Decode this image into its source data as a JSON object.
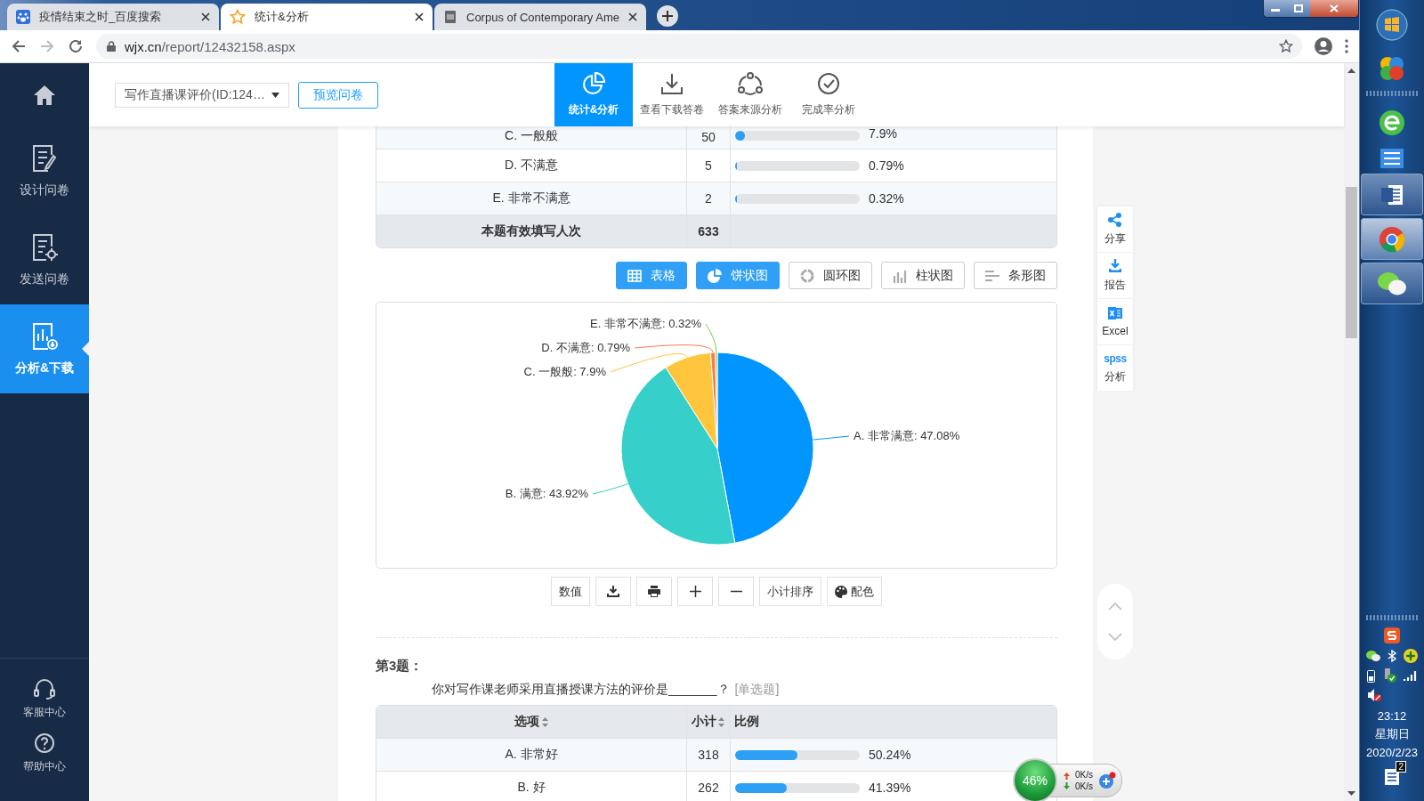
{
  "browser": {
    "tabs": [
      {
        "title": "疫情结束之时_百度搜索",
        "selected": false
      },
      {
        "title": "统计&分析",
        "selected": true
      },
      {
        "title": "Corpus of Contemporary Ame",
        "selected": false
      }
    ],
    "address": {
      "host": "wjx.cn",
      "path": "/report/12432158.aspx"
    }
  },
  "sidebar": {
    "items": [
      {
        "label": "设计问卷",
        "selected": false
      },
      {
        "label": "发送问卷",
        "selected": false
      },
      {
        "label": "分析&下载",
        "selected": true
      }
    ],
    "bottom_items": [
      {
        "kind": "service",
        "label": "客服中心"
      },
      {
        "kind": "help",
        "label": "帮助中心"
      }
    ]
  },
  "header": {
    "survey_select": "写作直播课评价(ID:124…",
    "preview_button": "预览问卷",
    "tabs": [
      {
        "kind": "stats",
        "label": "统计&分析",
        "selected": true
      },
      {
        "kind": "download",
        "label": "查看下载答卷",
        "selected": false
      },
      {
        "kind": "source",
        "label": "答案来源分析",
        "selected": false
      },
      {
        "kind": "completion",
        "label": "完成率分析",
        "selected": false
      }
    ]
  },
  "question_2": {
    "rows": [
      {
        "option": "C. 一般般",
        "count": "50",
        "level": 0.079,
        "percent": "7.9%"
      },
      {
        "option": "D. 不满意",
        "count": "5",
        "level": 0.0079,
        "percent": "0.79%"
      },
      {
        "option": "E. 非常不满意",
        "count": "2",
        "level": 0.0032,
        "percent": "0.32%"
      }
    ],
    "total": {
      "label": "本题有效填写人次",
      "value": "633"
    },
    "view_buttons": [
      {
        "kind": "table",
        "label": "表格",
        "selected": true
      },
      {
        "kind": "pie",
        "label": "饼状图",
        "selected": true
      },
      {
        "kind": "ring",
        "label": "圆环图",
        "selected": false
      },
      {
        "kind": "column",
        "label": "柱状图",
        "selected": false
      },
      {
        "kind": "bar",
        "label": "条形图",
        "selected": false
      }
    ],
    "chart_data": {
      "type": "pie",
      "categories": [
        "A. 非常满意",
        "B. 满意",
        "C. 一般般",
        "D. 不满意",
        "E. 非常不满意"
      ],
      "values": [
        47.08,
        43.92,
        7.9,
        0.79,
        0.32
      ],
      "value_labels": [
        ": 47.08%",
        ": 43.92%",
        ": 7.9%",
        ": 0.79%",
        ": 0.32%"
      ]
    },
    "tools": [
      {
        "kind": "text",
        "label": "数值"
      },
      {
        "kind": "download"
      },
      {
        "kind": "print"
      },
      {
        "kind": "zoom_in"
      },
      {
        "kind": "zoom_out"
      },
      {
        "kind": "text",
        "label": "小计排序"
      },
      {
        "kind": "palette",
        "label": "配色"
      }
    ]
  },
  "question_3": {
    "number": "第3题：",
    "text": "你对写作课老师采用直播授课方法的评价是_______？",
    "type": "[单选题]",
    "columns": [
      {
        "label": "选项",
        "sortable": true
      },
      {
        "label": "小计",
        "sortable": true
      },
      {
        "label": "比例",
        "sortable": false
      }
    ],
    "rows": [
      {
        "option": "A. 非常好",
        "count": "318",
        "level": 0.5024,
        "percent": "50.24%"
      },
      {
        "option": "B. 好",
        "count": "262",
        "level": 0.4139,
        "percent": "41.39%"
      }
    ]
  },
  "side_tools": [
    {
      "kind": "share",
      "label": "分享"
    },
    {
      "kind": "report",
      "label": "报告"
    },
    {
      "kind": "excel",
      "label": "Excel"
    },
    {
      "kind": "spss",
      "badge": "spss",
      "label": "分析"
    }
  ],
  "net_monitor": {
    "usage": "46%",
    "upload": "0K/s",
    "download": "0K/s"
  },
  "taskbar": {
    "time": "23:12",
    "weekday": "星期日",
    "date": "2020/2/23",
    "notifications": "2"
  }
}
